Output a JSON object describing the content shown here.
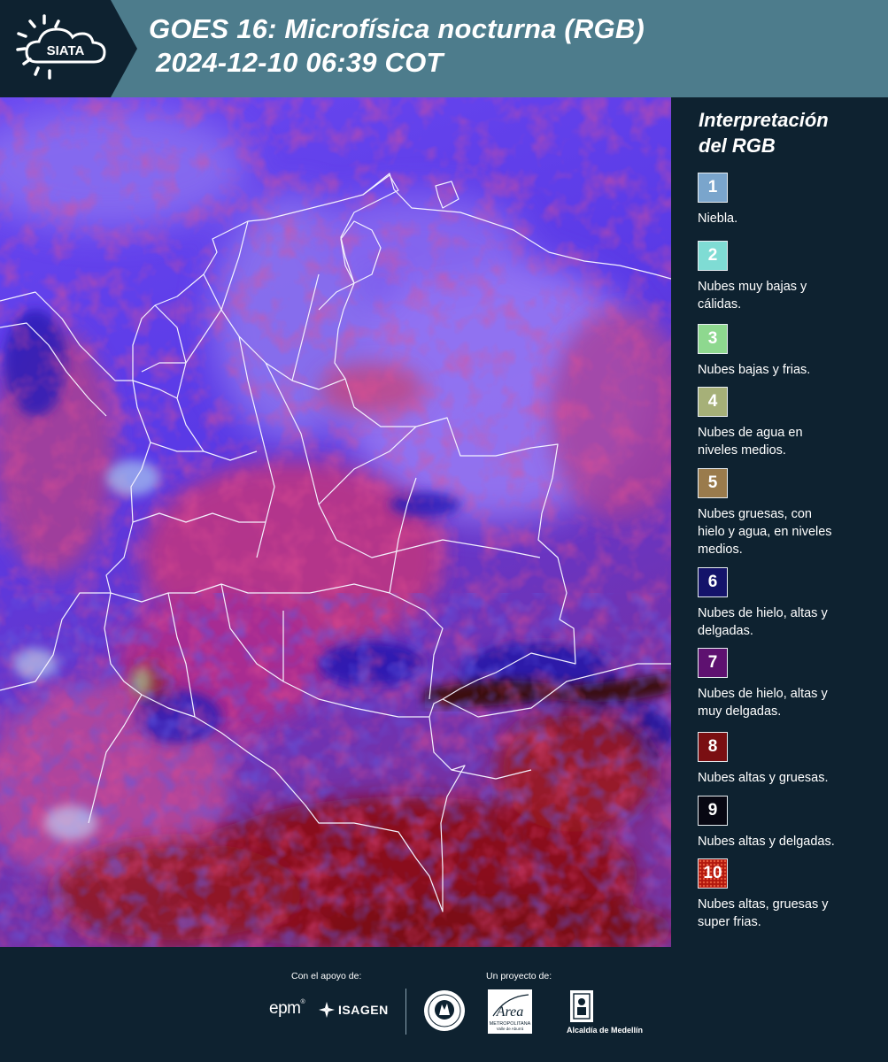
{
  "header": {
    "brand": "SIATA",
    "title_line1": "GOES 16: Microfísica nocturna (RGB)",
    "title_line2": "2024-12-10 06:39 COT",
    "background_color": "#4d7c8c"
  },
  "map": {
    "product": "GOES-16 Night Microphysics RGB",
    "region_features": [
      "Colombia",
      "Lago de Maracaibo",
      "Península de La Guajira"
    ]
  },
  "legend": {
    "title_line1": "Interpretación",
    "title_line2": "del RGB",
    "items": [
      {
        "number": "1",
        "color": "#7aa5cc",
        "label_lines": [
          "Niebla."
        ]
      },
      {
        "number": "2",
        "color": "#7fdcd4",
        "label_lines": [
          "Nubes muy bajas y",
          "cálidas."
        ]
      },
      {
        "number": "3",
        "color": "#8ed88f",
        "label_lines": [
          "Nubes bajas y frias."
        ]
      },
      {
        "number": "4",
        "color": "#a6b078",
        "label_lines": [
          "Nubes de agua en",
          "niveles medios."
        ]
      },
      {
        "number": "5",
        "color": "#9a7b4c",
        "label_lines": [
          "Nubes gruesas, con",
          "hielo y agua, en niveles",
          "medios."
        ]
      },
      {
        "number": "6",
        "color": "#14136a",
        "label_lines": [
          "Nubes de hielo, altas y",
          "delgadas."
        ]
      },
      {
        "number": "7",
        "color": "#5e1170",
        "label_lines": [
          "Nubes de hielo, altas y",
          "muy delgadas."
        ]
      },
      {
        "number": "8",
        "color": "#7a0f12",
        "label_lines": [
          "Nubes altas y gruesas."
        ]
      },
      {
        "number": "9",
        "color": "#070712",
        "label_lines": [
          "Nubes altas y delgadas."
        ]
      },
      {
        "number": "10",
        "color": "#b2180e",
        "label_lines": [
          "Nubes altas, gruesas y",
          "super frias."
        ]
      }
    ]
  },
  "footer": {
    "support_label": "Con el apoyo de:",
    "project_label": "Un proyecto de:",
    "sponsors": [
      "epm",
      "ISAGEN"
    ],
    "partners": [
      "Área Metropolitana Valle de Aburrá",
      "Alcaldía de Medellín"
    ],
    "area_logo_text": "Área",
    "area_logo_subtext1": "METROPOLITANA",
    "area_logo_subtext2": "Valle de Aburrá",
    "alcaldia_text": "Alcaldía de Medellín"
  }
}
